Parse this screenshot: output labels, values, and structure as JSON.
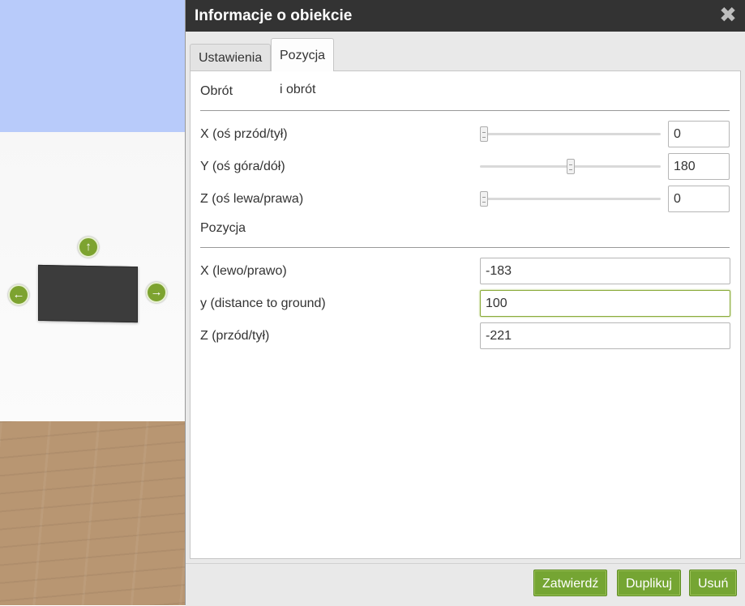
{
  "dialog": {
    "title": "Informacje o obiekcie",
    "close_icon": "close-x-icon"
  },
  "tabs": [
    {
      "label": "Ustawienia",
      "active": false
    },
    {
      "label": "Pozycja i obrót",
      "active": true
    }
  ],
  "rotation": {
    "heading": "Obrót",
    "rows": [
      {
        "label": "X (oś przód/tył)",
        "value": "0",
        "slider_fraction": 0.0
      },
      {
        "label": "Y (oś góra/dół)",
        "value": "180",
        "slider_fraction": 0.5
      },
      {
        "label": "Z (oś lewa/prawa)",
        "value": "0",
        "slider_fraction": 0.0
      }
    ]
  },
  "position": {
    "heading": "Pozycja",
    "rows": [
      {
        "label": "X (lewo/prawo)",
        "value": "-183"
      },
      {
        "label": "y (distance to ground)",
        "value": "100"
      },
      {
        "label": "Z (przód/tył)",
        "value": "-221"
      }
    ]
  },
  "buttons": {
    "confirm": "Zatwierdź",
    "duplicate": "Duplikuj",
    "delete": "Usuń"
  },
  "scene": {
    "arrow_icons": [
      "arrow-up-icon",
      "arrow-left-icon",
      "arrow-right-icon"
    ],
    "accent_color": "#75a533"
  }
}
